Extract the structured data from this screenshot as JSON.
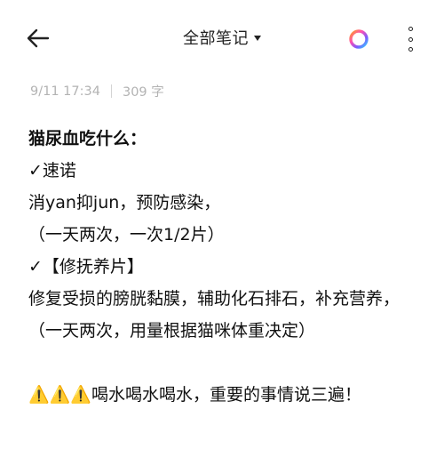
{
  "header": {
    "back_icon": "arrow-left-icon",
    "title": "全部笔记",
    "title_dropdown_icon": "caret-down-icon",
    "theme_icon": "color-ring-icon",
    "more_icon": "more-vertical-icon"
  },
  "meta": {
    "datetime": "9/11 17:34",
    "word_count": "309 字"
  },
  "note": {
    "lines": [
      "猫尿血吃什么：",
      "✓速诺",
      "消yan抑jun，预防感染，",
      "（一天两次，一次1/2片）",
      "✓【修抚养片】",
      "修复受损的膀胱黏膜，辅助化石排石，补充营养，",
      "（一天两次，用量根据猫咪体重决定）",
      "",
      "⚠️⚠️⚠️喝水喝水喝水，重要的事情说三遍！"
    ]
  },
  "colors": {
    "text": "#111111",
    "meta_text": "#b3b3b3",
    "background": "#ffffff"
  }
}
